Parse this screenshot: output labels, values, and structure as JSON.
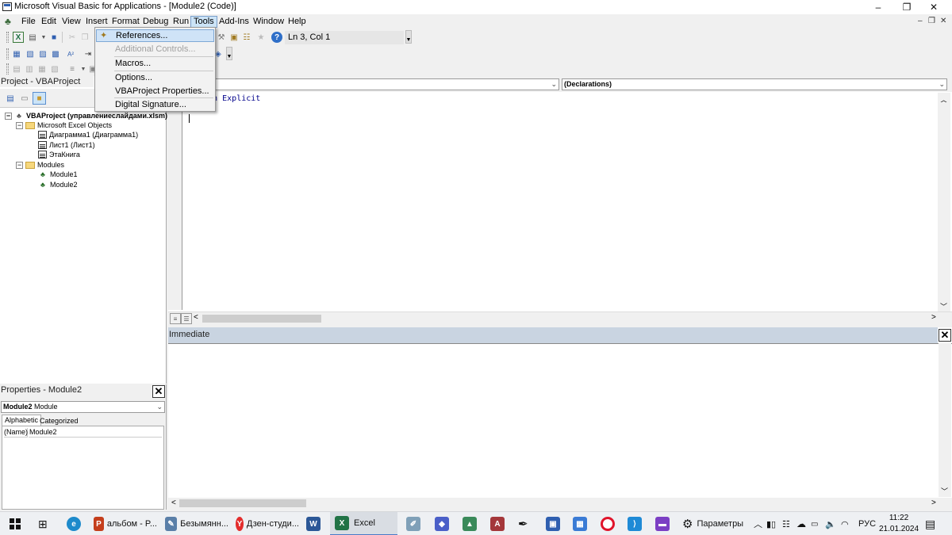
{
  "window": {
    "title": "Microsoft Visual Basic for Applications - [Module2 (Code)]",
    "minimize": "–",
    "restore": "❐",
    "close": "✕",
    "mdi_minimize": "–",
    "mdi_restore": "❐",
    "mdi_close": "✕"
  },
  "menubar": {
    "items": [
      "File",
      "Edit",
      "View",
      "Insert",
      "Format",
      "Debug",
      "Run",
      "Tools",
      "Add-Ins",
      "Window",
      "Help"
    ],
    "open_menu": "Tools"
  },
  "toolbar": {
    "status": "Ln 3, Col 1"
  },
  "tools_menu": {
    "items": [
      {
        "label": "References...",
        "enabled": true,
        "highlighted": true
      },
      {
        "label": "Additional Controls...",
        "enabled": false,
        "highlighted": false
      },
      {
        "label": "Macros...",
        "enabled": true,
        "highlighted": false
      },
      {
        "label": "Options...",
        "enabled": true,
        "highlighted": false
      },
      {
        "label": "VBAProject Properties...",
        "enabled": true,
        "highlighted": false
      },
      {
        "label": "Digital Signature...",
        "enabled": true,
        "highlighted": false
      }
    ]
  },
  "project_explorer": {
    "title": "Project - VBAProject",
    "tree": [
      {
        "label": "VBAProject (управлениеслайдами.xlsm)",
        "level": 0,
        "kind": "project"
      },
      {
        "label": "Microsoft Excel Objects",
        "level": 1,
        "kind": "folder"
      },
      {
        "label": "Диаграмма1 (Диаграмма1)",
        "level": 2,
        "kind": "sheet"
      },
      {
        "label": "Лист1 (Лист1)",
        "level": 2,
        "kind": "sheet"
      },
      {
        "label": "ЭтаКнига",
        "level": 2,
        "kind": "sheet"
      },
      {
        "label": "Modules",
        "level": 1,
        "kind": "folder"
      },
      {
        "label": "Module1",
        "level": 2,
        "kind": "module"
      },
      {
        "label": "Module2",
        "level": 2,
        "kind": "module"
      }
    ]
  },
  "properties": {
    "title": "Properties - Module2",
    "object_name": "Module2",
    "object_type": "Module",
    "tabs": [
      "Alphabetic",
      "Categorized"
    ],
    "rows": [
      {
        "name": "(Name)",
        "value": "Module2"
      }
    ]
  },
  "code_window": {
    "object_combo": "",
    "procedure_combo": "(Declarations)",
    "code_lines": [
      "Option Explicit"
    ]
  },
  "immediate": {
    "title": "Immediate"
  },
  "taskbar": {
    "items": [
      {
        "label": "альбом - P...",
        "color": "#c43e1c",
        "glyph": "P"
      },
      {
        "label": "Безымянн...",
        "color": "#5a7fa8",
        "glyph": "✎"
      },
      {
        "label": "Дзен-студи...",
        "color": "#e32d2d",
        "glyph": "Y"
      },
      {
        "label": "",
        "color": "#2b5797",
        "glyph": "W"
      },
      {
        "label": "Excel",
        "color": "#217346",
        "glyph": "X"
      }
    ],
    "settings_label": "Параметры",
    "language": "РУС",
    "time": "11:22",
    "date": "21.01.2024"
  }
}
